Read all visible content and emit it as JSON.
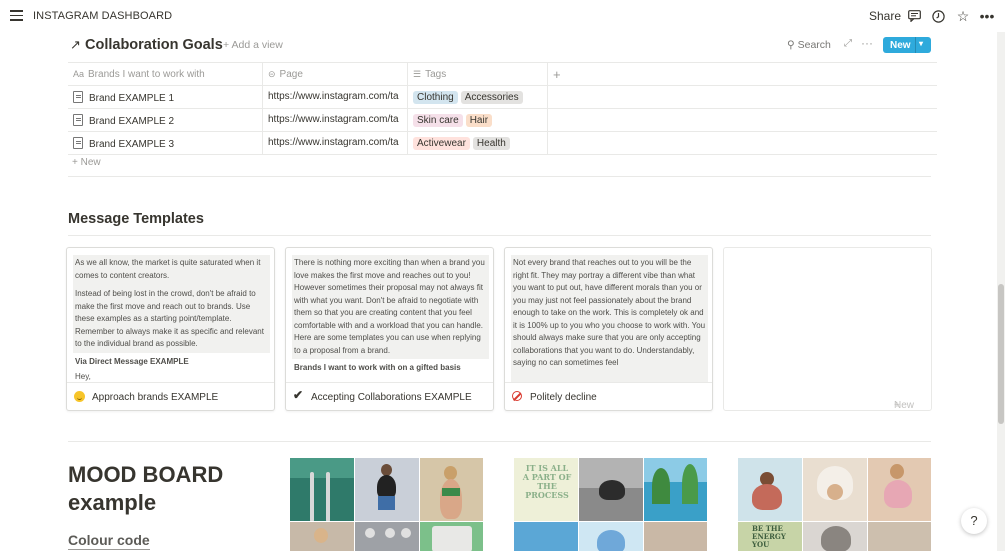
{
  "app": {
    "title": "INSTAGRAM DASHBOARD",
    "share_label": "Share"
  },
  "database": {
    "title": "Collaboration Goals",
    "add_view_label": "Add a view",
    "search_label": "Search",
    "new_label": "New",
    "columns": [
      "Brands I want to work with",
      "Page",
      "Tags"
    ],
    "rows": [
      {
        "name": "Brand EXAMPLE 1",
        "page": "https://www.instagram.com/ta",
        "tags": [
          {
            "label": "Clothing",
            "color": "#d3e5ef"
          },
          {
            "label": "Accessories",
            "color": "#e3e2e0"
          }
        ]
      },
      {
        "name": "Brand EXAMPLE 2",
        "page": "https://www.instagram.com/ta",
        "tags": [
          {
            "label": "Skin care",
            "color": "#f5e0e9"
          },
          {
            "label": "Hair",
            "color": "#fadec9"
          }
        ]
      },
      {
        "name": "Brand EXAMPLE 3",
        "page": "https://www.instagram.com/ta",
        "tags": [
          {
            "label": "Activewear",
            "color": "#ffe2dd"
          },
          {
            "label": "Health",
            "color": "#e3e2e0"
          }
        ]
      }
    ],
    "new_row_label": "New"
  },
  "templates": {
    "heading": "Message Templates",
    "cards": [
      {
        "title": "Approach brands EXAMPLE",
        "icon": "smile-emoji-icon",
        "paragraphs": [
          "As we all know, the market is quite saturated when it comes to content creators.",
          "Instead of being lost in the crowd, don't be afraid to make the first move and reach out to brands. Use these examples as a starting point/template. Remember to always make it as specific and relevant to the individual brand as possible."
        ],
        "bold": "Via Direct Message EXAMPLE",
        "after": "Hey,"
      },
      {
        "title": "Accepting Collaborations EXAMPLE",
        "icon": "check-mark-icon",
        "paragraphs": [
          "There is nothing more exciting than when a brand you love makes the first move and reaches out to you! However sometimes their proposal may not always fit with what you want. Don't be afraid to negotiate with them so that you are creating content that you feel comfortable with and a workload that you can handle. Here are some templates you can use when replying to a proposal from a brand."
        ],
        "bold": "Brands I want to work with on a gifted basis",
        "after": ""
      },
      {
        "title": "Politely decline",
        "icon": "no-entry-icon",
        "paragraphs": [
          "Not every brand that reaches out to you will be the right fit. They may portray a different vibe than what you want to put out, have different morals than you or you may just not feel passionately about the brand enough to take on the work. This is completely ok and it is 100% up to you who you choose to work with. You should always make sure that you are only accepting collaborations that you want to do. Understandably, saying no can sometimes feel"
        ],
        "bold": "",
        "after": ""
      }
    ],
    "new_card_label": "New"
  },
  "moodboard": {
    "title": "MOOD BOARD example",
    "colour_code_label": "Colour code",
    "boards": [
      {
        "name": "board-1",
        "tiles": [
          "#2f7a6a",
          "#7f8a9e",
          "#d6c6a8",
          "#b9bcc0",
          "#5a5d62",
          "#7cc08a"
        ]
      },
      {
        "name": "board-2",
        "tiles": [
          "#eef0d8",
          "#9d9d9d",
          "#3aa0c8",
          "#5ba7d6",
          "#cfe7f3",
          "#c9b8a6"
        ]
      },
      {
        "name": "board-3",
        "tiles": [
          "#cfe3ea",
          "#d7cbbd",
          "#e7a7b4",
          "#5e7f6c",
          "#dad6d2",
          "#c7d4a7"
        ]
      }
    ],
    "board3_text": "BE THE ENERGY YOU"
  },
  "colors": {
    "accent": "#2eaadc"
  }
}
